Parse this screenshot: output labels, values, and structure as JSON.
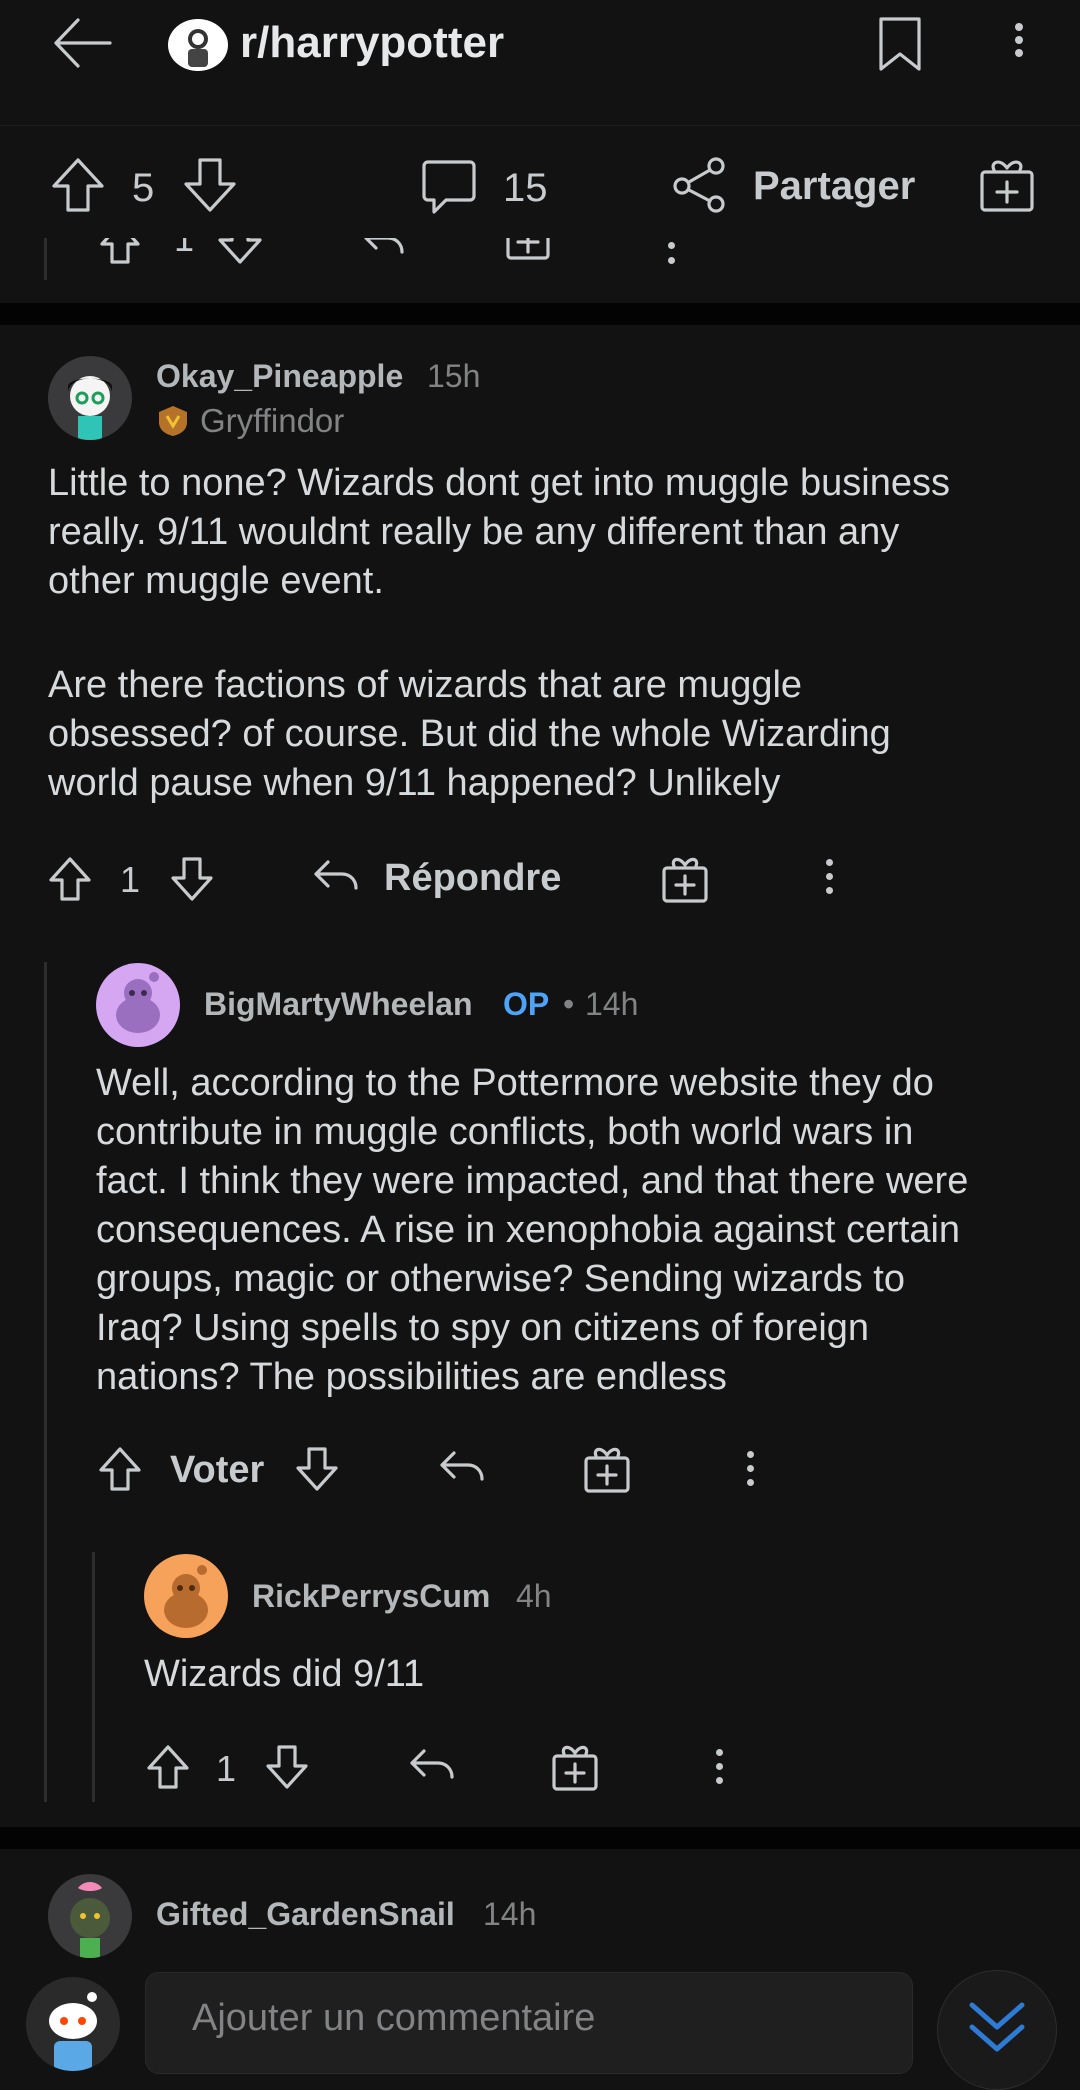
{
  "header": {
    "subreddit": "r/harrypotter"
  },
  "post_actions": {
    "score": "5",
    "comments": "15",
    "share_label": "Partager",
    "partial_score": "1"
  },
  "comments": [
    {
      "author": "Okay_Pineapple",
      "time": "15h",
      "flair": "Gryffindor",
      "body_lines": [
        "Little to none? Wizards dont get into muggle business",
        "really. 9/11 wouldnt really be any different than any",
        "other muggle event."
      ],
      "body_lines_2": [
        "Are there factions of wizards that are muggle",
        "obsessed? of course. But did the whole Wizarding",
        "world pause when 9/11 happened? Unlikely"
      ],
      "score": "1",
      "reply_label": "Répondre"
    },
    {
      "author": "BigMartyWheelan",
      "op_badge": "OP",
      "dot": "•",
      "time": "14h",
      "body_lines": [
        "Well, according to the Pottermore website they do",
        "contribute in muggle conflicts, both world wars in",
        "fact. I think they were impacted, and that there were",
        "consequences. A rise in xenophobia against certain",
        "groups, magic or otherwise? Sending wizards to",
        "Iraq? Using spells to spy on citizens of foreign",
        "nations? The possibilities are endless"
      ],
      "vote_label": "Voter"
    },
    {
      "author": "RickPerrysCum",
      "time": "4h",
      "body_lines": [
        "Wizards did 9/11"
      ],
      "score": "1"
    },
    {
      "author": "Gifted_GardenSnail",
      "time": "14h"
    }
  ],
  "composer": {
    "placeholder": "Ajouter un commentaire"
  },
  "colors": {
    "background": "#121212",
    "op_blue": "#4fa3f7",
    "avatar_purple": "#d5a6f2",
    "avatar_orange": "#f7a25a"
  }
}
